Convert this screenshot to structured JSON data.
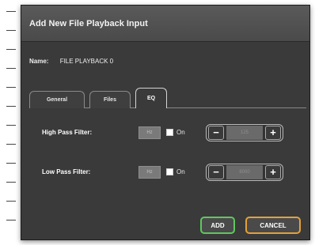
{
  "dialog": {
    "title": "Add New File Playback Input",
    "name_label": "Name:",
    "name_value": "FILE PLAYBACK 0"
  },
  "tabs": [
    {
      "label": "General",
      "active": false
    },
    {
      "label": "Files",
      "active": false
    },
    {
      "label": "EQ",
      "active": true
    }
  ],
  "filters": [
    {
      "label": "High Pass Filter:",
      "value_box": "Hz",
      "on_label": "On",
      "checked": false,
      "stepper_value": "125"
    },
    {
      "label": "Low Pass Filter:",
      "value_box": "Hz",
      "on_label": "On",
      "checked": false,
      "stepper_value": "8000"
    }
  ],
  "stepper_minus": "−",
  "stepper_plus": "+",
  "buttons": {
    "add": "ADD",
    "cancel": "CANCEL"
  },
  "colors": {
    "dialog_bg": "#3a3a3a",
    "header_bg": "#4f4f4f",
    "add_border": "#5ec85e",
    "cancel_border": "#e3a13a"
  }
}
